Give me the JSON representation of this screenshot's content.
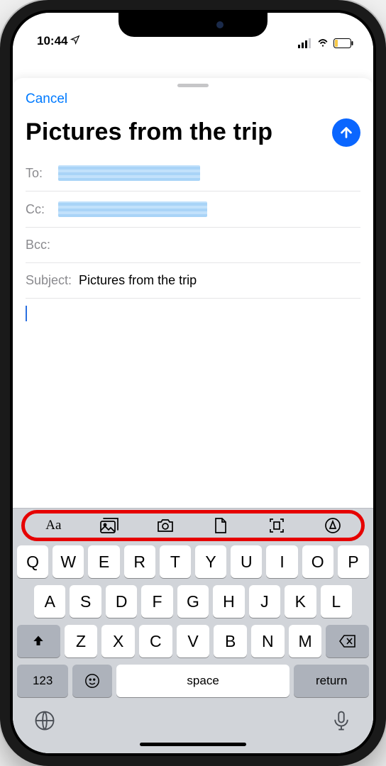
{
  "statusbar": {
    "time": "10:44"
  },
  "compose": {
    "cancel": "Cancel",
    "title": "Pictures from the trip",
    "fields": {
      "to_label": "To:",
      "cc_label": "Cc:",
      "bcc_label": "Bcc:",
      "subject_label": "Subject:",
      "subject_value": "Pictures from the trip"
    }
  },
  "quickbar": {
    "text_format": "Aa"
  },
  "keyboard": {
    "row1": [
      "Q",
      "W",
      "E",
      "R",
      "T",
      "Y",
      "U",
      "I",
      "O",
      "P"
    ],
    "row2": [
      "A",
      "S",
      "D",
      "F",
      "G",
      "H",
      "J",
      "K",
      "L"
    ],
    "row3": [
      "Z",
      "X",
      "C",
      "V",
      "B",
      "N",
      "M"
    ],
    "num_key": "123",
    "space": "space",
    "return": "return"
  }
}
